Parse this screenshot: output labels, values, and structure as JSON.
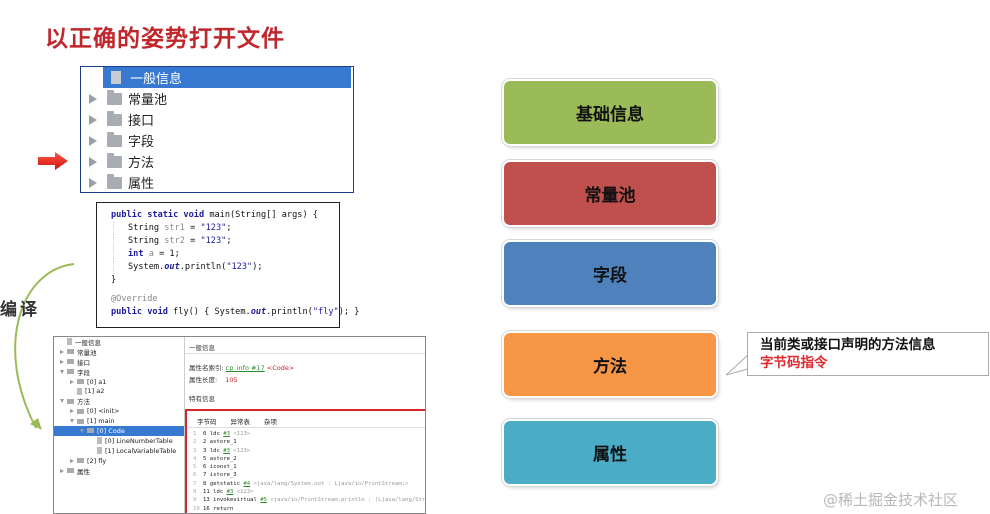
{
  "title": "以正确的姿势打开文件",
  "tree_top": {
    "items": [
      {
        "label": "一般信息",
        "selected": true
      },
      {
        "label": "常量池"
      },
      {
        "label": "接口"
      },
      {
        "label": "字段"
      },
      {
        "label": "方法"
      },
      {
        "label": "属性"
      }
    ]
  },
  "code": {
    "l1a": "public static void ",
    "l1b": "main(String[] args) {",
    "l2a": "String ",
    "l2b": "str1",
    "l2c": " = ",
    "l2d": "\"123\"",
    "l2e": ";",
    "l3a": "String ",
    "l3b": "str2",
    "l3c": " = ",
    "l3d": "\"123\"",
    "l3e": ";",
    "l4a": "int ",
    "l4b": "a",
    "l4c": " = 1;",
    "l5a": "System.",
    "l5b": "out",
    "l5c": ".println(",
    "l5d": "\"123\"",
    "l5e": ");",
    "l6": "}",
    "l7": "@Override",
    "l8a": "public void ",
    "l8b": "fly() { System.",
    "l8c": "out",
    "l8d": ".println(",
    "l8e": "\"fly\"",
    "l8f": "); }"
  },
  "compile_label": "编译",
  "panel": {
    "tree": [
      {
        "label": "一般信息",
        "indent": 0,
        "kind": "doc"
      },
      {
        "label": "常量池",
        "indent": 0,
        "kind": "folder",
        "tri": "r"
      },
      {
        "label": "接口",
        "indent": 0,
        "kind": "folder",
        "tri": "r"
      },
      {
        "label": "字段",
        "indent": 0,
        "kind": "folder",
        "tri": "d"
      },
      {
        "label": "[0] a1",
        "indent": 1,
        "kind": "folder",
        "tri": "r"
      },
      {
        "label": "[1] a2",
        "indent": 1,
        "kind": "doc"
      },
      {
        "label": "方法",
        "indent": 0,
        "kind": "folder",
        "tri": "d"
      },
      {
        "label": "[0] <init>",
        "indent": 1,
        "kind": "folder",
        "tri": "r"
      },
      {
        "label": "[1] main",
        "indent": 1,
        "kind": "folder",
        "tri": "d"
      },
      {
        "label": "[0] Code",
        "indent": 2,
        "kind": "folder",
        "tri": "d",
        "selected": true
      },
      {
        "label": "[0] LineNumberTable",
        "indent": 3,
        "kind": "doc"
      },
      {
        "label": "[1] LocalVariableTable",
        "indent": 3,
        "kind": "doc"
      },
      {
        "label": "[2] fly",
        "indent": 1,
        "kind": "folder",
        "tri": "r"
      },
      {
        "label": "属性",
        "indent": 0,
        "kind": "folder",
        "tri": "r"
      }
    ],
    "general_header": "一般信息",
    "attr_name_label": "属性名索引:",
    "attr_name_link": "cp_info #17",
    "attr_name_value": "<Code>",
    "attr_len_label": "属性长度:",
    "attr_len_value": "105",
    "specific_header": "特有信息",
    "tabs": [
      "字节码",
      "异常表",
      "杂项"
    ],
    "bytecode": [
      {
        "n": "1",
        "code": "0 ldc ",
        "ref": "#3",
        "cmt": " <123>"
      },
      {
        "n": "2",
        "code": "2 astore_1",
        "ref": "",
        "cmt": ""
      },
      {
        "n": "3",
        "code": "3 ldc ",
        "ref": "#3",
        "cmt": " <123>"
      },
      {
        "n": "4",
        "code": "5 astore_2",
        "ref": "",
        "cmt": ""
      },
      {
        "n": "5",
        "code": "6 iconst_1",
        "ref": "",
        "cmt": ""
      },
      {
        "n": "6",
        "code": "7 istore_3",
        "ref": "",
        "cmt": ""
      },
      {
        "n": "7",
        "code": "8 getstatic ",
        "ref": "#4",
        "cmt": " <java/lang/System.out : Ljava/io/PrintStream;>"
      },
      {
        "n": "8",
        "code": "11 ldc ",
        "ref": "#3",
        "cmt": " <123>"
      },
      {
        "n": "9",
        "code": "13 invokevirtual ",
        "ref": "#5",
        "cmt": " <java/io/PrintStream.println : (Ljava/lang/String;)V"
      },
      {
        "n": "10",
        "code": "16 return",
        "ref": "",
        "cmt": ""
      }
    ]
  },
  "boxes": [
    {
      "label": "基础信息",
      "color": "#9bbb59"
    },
    {
      "label": "常量池",
      "color": "#c0504d"
    },
    {
      "label": "字段",
      "color": "#4f81bd"
    },
    {
      "label": "方法",
      "color": "#f79646"
    },
    {
      "label": "属性",
      "color": "#4bacc6"
    }
  ],
  "callout": {
    "line1": "当前类或接口声明的方法信息",
    "line2": "字节码指令"
  },
  "watermark": "@稀土掘金技术社区"
}
